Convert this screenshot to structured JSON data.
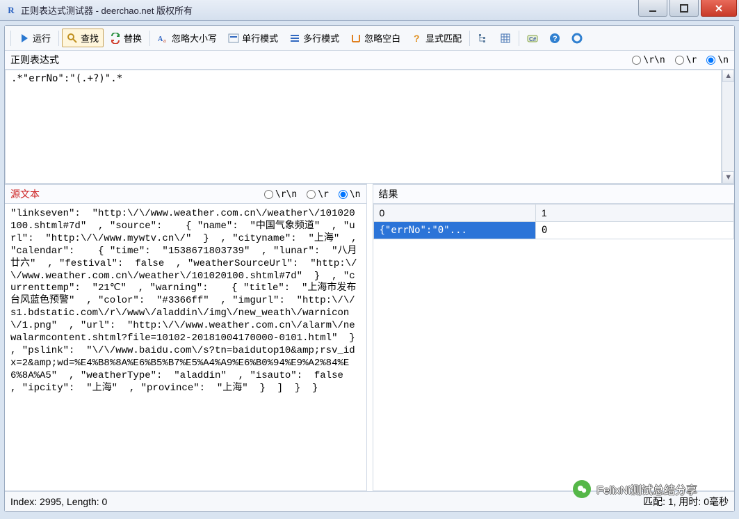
{
  "window": {
    "title": "正则表达式测试器 - deerchao.net 版权所有"
  },
  "toolbar": {
    "run": "运行",
    "find": "查找",
    "replace": "替换",
    "ignoreCase": "忽略大小写",
    "singleLine": "单行模式",
    "multiLine": "多行模式",
    "ignoreWhitespace": "忽略空白",
    "explicitMatch": "显式匹配"
  },
  "regex": {
    "label": "正则表达式",
    "lineEndings": {
      "rn": "\\r\\n",
      "r": "\\r",
      "n": "\\n"
    },
    "pattern": ".*\"errNo\":\"(.+?)\".*"
  },
  "source": {
    "label": "源文本",
    "lineEndings": {
      "rn": "\\r\\n",
      "r": "\\r",
      "n": "\\n"
    },
    "text": "\"linkseven\":  \"http:\\/\\/www.weather.com.cn\\/weather\\/101020100.shtml#7d\"  , \"source\":    { \"name\":  \"中国气象频道\"  , \"url\":  \"http:\\/\\/www.mywtv.cn\\/\"  }  , \"cityname\":  \"上海\"  , \"calendar\":    { \"time\":  \"1538671803739\"  , \"lunar\":  \"八月廿六\"  , \"festival\":  false  , \"weatherSourceUrl\":  \"http:\\/\\/www.weather.com.cn\\/weather\\/101020100.shtml#7d\"  }  , \"currenttemp\":  \"21℃\"  , \"warning\":    { \"title\":  \"上海市发布台风蓝色预警\"  , \"color\":  \"#3366ff\"  , \"imgurl\":  \"http:\\/\\/s1.bdstatic.com\\/r\\/www\\/aladdin\\/img\\/new_weath\\/warnicon\\/1.png\"  , \"url\":  \"http:\\/\\/www.weather.com.cn\\/alarm\\/newalarmcontent.shtml?file=10102-20181004170000-0101.html\"  }  , \"pslink\":  \"\\/\\/www.baidu.com\\/s?tn=baidutop10&amp;rsv_idx=2&amp;wd=%E4%B8%8A%E6%B5%B7%E5%A4%A9%E6%B0%94%E9%A2%84%E6%8A%A5\"  , \"weatherType\":  \"aladdin\"  , \"isauto\":  false  , \"ipcity\":  \"上海\"  , \"province\":  \"上海\"  }  ]  }  }"
  },
  "result": {
    "label": "结果",
    "columns": [
      "0",
      "1"
    ],
    "rows": [
      {
        "c0": "{\"errNo\":\"0\"...",
        "c1": "0"
      }
    ]
  },
  "footer": {
    "left": "Index: 2995, Length: 0",
    "right": "匹配: 1, 用时: 0毫秒"
  },
  "watermark": "FelixNi测试总结分享"
}
